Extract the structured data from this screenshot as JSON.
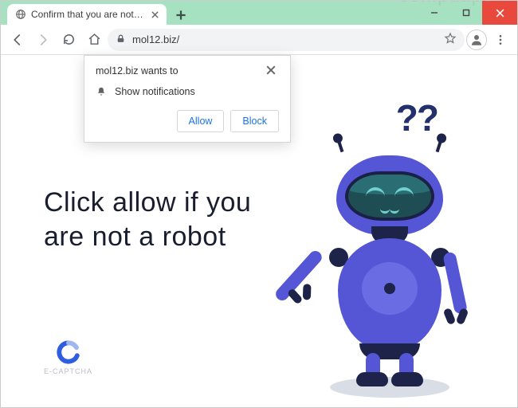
{
  "window": {
    "tab_title": "Confirm that you are not a robot"
  },
  "toolbar": {
    "url": "mol12.biz/"
  },
  "notification": {
    "title": "mol12.biz wants to",
    "permission_text": "Show notifications",
    "allow_label": "Allow",
    "block_label": "Block"
  },
  "page": {
    "heading": "Click allow if you are not a robot",
    "captcha_label": "E-CAPTCHA",
    "question_marks": "??",
    "watermark": "computips"
  }
}
